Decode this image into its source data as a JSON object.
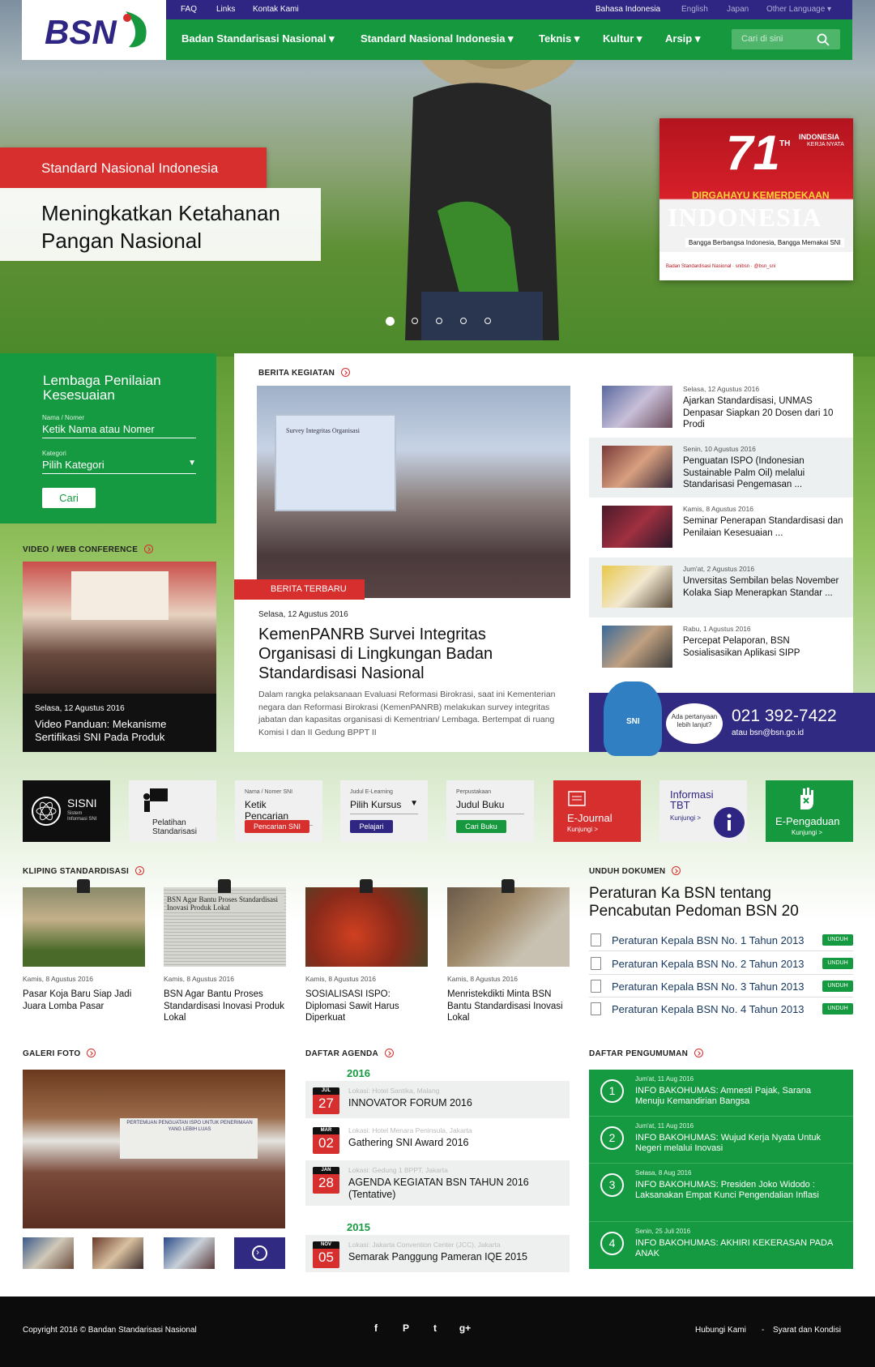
{
  "colors": {
    "green": "#16983f",
    "navy": "#2e2682",
    "red": "#d72e2e"
  },
  "logo": "BSN",
  "topbar": {
    "links": [
      "FAQ",
      "Links",
      "Kontak Kami"
    ],
    "languages": [
      "Bahasa Indonesia",
      "English",
      "Japan",
      "Other Language ▾"
    ]
  },
  "nav": {
    "items": [
      "Badan Standarisasi Nasional ▾",
      "Standard Nasional Indonesia ▾",
      "Teknis ▾",
      "Kultur ▾",
      "Arsip ▾"
    ],
    "search_placeholder": "Cari di sini"
  },
  "hero": {
    "tag": "Standard Nasional Indonesia",
    "title": "Meningkatkan Ketahanan Pangan Nasional",
    "promo": {
      "num": "71",
      "super": "TH",
      "line1": "INDONESIA",
      "line2": "KERJA NYATA",
      "dirgahayu": "DIRGAHAYU KEMERDEKAAN",
      "big": "INDONESIA",
      "strap": "Bangga Berbangsa Indonesia, Bangga Memakai SNI",
      "footer": "Badan Standardisasi Nasional · snibsn · @bsn_sni"
    },
    "slides_active": 1,
    "slides_total": 5
  },
  "lpk": {
    "title": "Lembaga Penilaian Kesesuaian",
    "name_label": "Nama / Nomer",
    "name_placeholder": "Ketik Nama atau Nomer",
    "cat_label": "Kategori",
    "cat_value": "Pilih Kategori",
    "button": "Cari"
  },
  "video": {
    "header": "VIDEO / WEB CONFERENCE",
    "date": "Selasa, 12 Agustus 2016",
    "title": "Video Panduan: Mekanisme Sertifikasi SNI Pada Produk"
  },
  "berita": {
    "header": "BERITA KEGIATAN",
    "tag": "BERITA TERBARU",
    "date": "Selasa, 12 Agustus 2016",
    "title": "KemenPANRB Survei Integritas Organisasi di Lingkungan Badan Standardisasi Nasional",
    "desc": "Dalam rangka pelaksanaan Evaluasi Reformasi Birokrasi, saat ini Kementerian negara dan Reformasi Birokrasi (KemenPANRB) melakukan survey integritas jabatan dan kapasitas organisasi di Kementrian/ Lembaga. Bertempat di ruang Komisi I dan II Gedung BPPT II",
    "screen_text": "Survey Integritas Organisasi",
    "side": [
      {
        "date": "Selasa, 12 Agustus 2016",
        "title": "Ajarkan Standardisasi, UNMAS Denpasar Siapkan 20 Dosen dari 10 Prodi"
      },
      {
        "date": "Senin, 10 Agustus 2016",
        "title": "Penguatan ISPO (Indonesian Sustainable Palm Oil) melalui Standarisasi Pengemasan ..."
      },
      {
        "date": "Kamis, 8 Agustus 2016",
        "title": "Seminar Penerapan Standardisasi dan Penilaian Kesesuaian ..."
      },
      {
        "date": "Jum'at, 2 Agustus 2016",
        "title": "Unversitas Sembilan belas November Kolaka Siap Menerapkan Standar ..."
      },
      {
        "date": "Rabu, 1 Agustus 2016",
        "title": "Percepat Pelaporan, BSN Sosialisasikan Aplikasi SIPP"
      }
    ]
  },
  "hotline": {
    "bubble": "Ada pertanyaan lebih lanjut?",
    "number": "021 392-7422",
    "email": "atau bsn@bsn.go.id",
    "mascot": "SNI"
  },
  "tiles": {
    "sisni": {
      "title": "SISNI",
      "sub": "Sistem Informasi SNI"
    },
    "pelatihan": "Pelatihan Standarisasi",
    "sni": {
      "label": "Nama / Nomer SNI",
      "value": "Ketik Pencarian",
      "button": "Pencarian SNI"
    },
    "elearning": {
      "label": "Judul E-Learning",
      "value": "Pilih Kursus",
      "button": "Pelajari"
    },
    "perpus": {
      "label": "Perpustakaan",
      "value": "Judul Buku",
      "button": "Cari Buku"
    },
    "ejournal": {
      "title": "E-Journal",
      "sub": "Kunjungi >"
    },
    "tbt": {
      "title": "Informasi TBT",
      "sub": "Kunjungi >"
    },
    "pengaduan": {
      "title": "E-Pengaduan",
      "sub": "Kunjungi >"
    }
  },
  "kliping": {
    "header": "KLIPING STANDARDISASI",
    "items": [
      {
        "date": "Kamis, 8 Agustus 2016",
        "title": "Pasar Koja Baru Siap Jadi Juara Lomba Pasar"
      },
      {
        "date": "Kamis, 8 Agustus 2016",
        "title": "BSN Agar Bantu Proses Standardisasi Inovasi Produk Lokal",
        "headline": "BSN Agar Bantu Proses Standardisasi Inovasi Produk Lokal"
      },
      {
        "date": "Kamis, 8 Agustus 2016",
        "title": "SOSIALISASI ISPO: Diplomasi Sawit Harus Diperkuat"
      },
      {
        "date": "Kamis, 8 Agustus 2016",
        "title": "Menristekdikti Minta BSN Bantu Standardisasi Inovasi Lokal"
      }
    ]
  },
  "unduh": {
    "header": "UNDUH DOKUMEN",
    "title": "Peraturan Ka BSN tentang Pencabutan Pedoman BSN 20",
    "button": "UNDUH",
    "items": [
      "Peraturan Kepala BSN No. 1 Tahun 2013",
      "Peraturan Kepala BSN No. 2 Tahun 2013",
      "Peraturan Kepala BSN No. 3 Tahun 2013",
      "Peraturan Kepala BSN No. 4 Tahun 2013"
    ]
  },
  "galeri": {
    "header": "GALERI FOTO",
    "banner": "PERTEMUAN PENGUATAN ISPO UNTUK PENERIMAAN YANG LEBIH LUAS"
  },
  "agenda": {
    "header": "DAFTAR AGENDA",
    "year1": "2016",
    "year2": "2015",
    "items": [
      {
        "month": "JUL",
        "day": "27",
        "loc": "Lokasi: Hotel Santika, Malang",
        "title": "INNOVATOR FORUM 2016"
      },
      {
        "month": "MAR",
        "day": "02",
        "loc": "Lokasi: Hotel Menara Peninsula, Jakarta",
        "title": "Gathering SNI Award 2016"
      },
      {
        "month": "JAN",
        "day": "28",
        "loc": "Lokasi: Gedung 1 BPPT, Jakarta",
        "title": "AGENDA KEGIATAN BSN TAHUN 2016 (Tentative)"
      },
      {
        "month": "NOV",
        "day": "05",
        "loc": "Lokasi: Jakarta Convention Center (JCC), Jakarta",
        "title": "Semarak Panggung Pameran IQE 2015"
      }
    ]
  },
  "pengumuman": {
    "header": "DAFTAR PENGUMUMAN",
    "items": [
      {
        "n": "1",
        "date": "Jum'at, 11 Aug 2016",
        "title": "INFO BAKOHUMAS: Amnesti Pajak, Sarana Menuju Kemandirian Bangsa"
      },
      {
        "n": "2",
        "date": "Jum'at, 11 Aug 2016",
        "title": "INFO BAKOHUMAS: Wujud Kerja Nyata Untuk Negeri melalui Inovasi"
      },
      {
        "n": "3",
        "date": "Selasa, 8 Aug 2016",
        "title": "INFO BAKOHUMAS: Presiden Joko Widodo : Laksanakan Empat Kunci Pengendalian Inflasi"
      },
      {
        "n": "4",
        "date": "Senin, 25 Juli 2016",
        "title": "INFO BAKOHUMAS: AKHIRI KEKERASAN PADA ANAK"
      }
    ]
  },
  "footer": {
    "copyright": "Copyright 2016 © Bandan Standarisasi Nasional",
    "links": [
      "Hubungi Kami",
      "-",
      "Syarat dan Kondisi"
    ],
    "social": [
      "f",
      "P",
      "t",
      "g+"
    ]
  }
}
